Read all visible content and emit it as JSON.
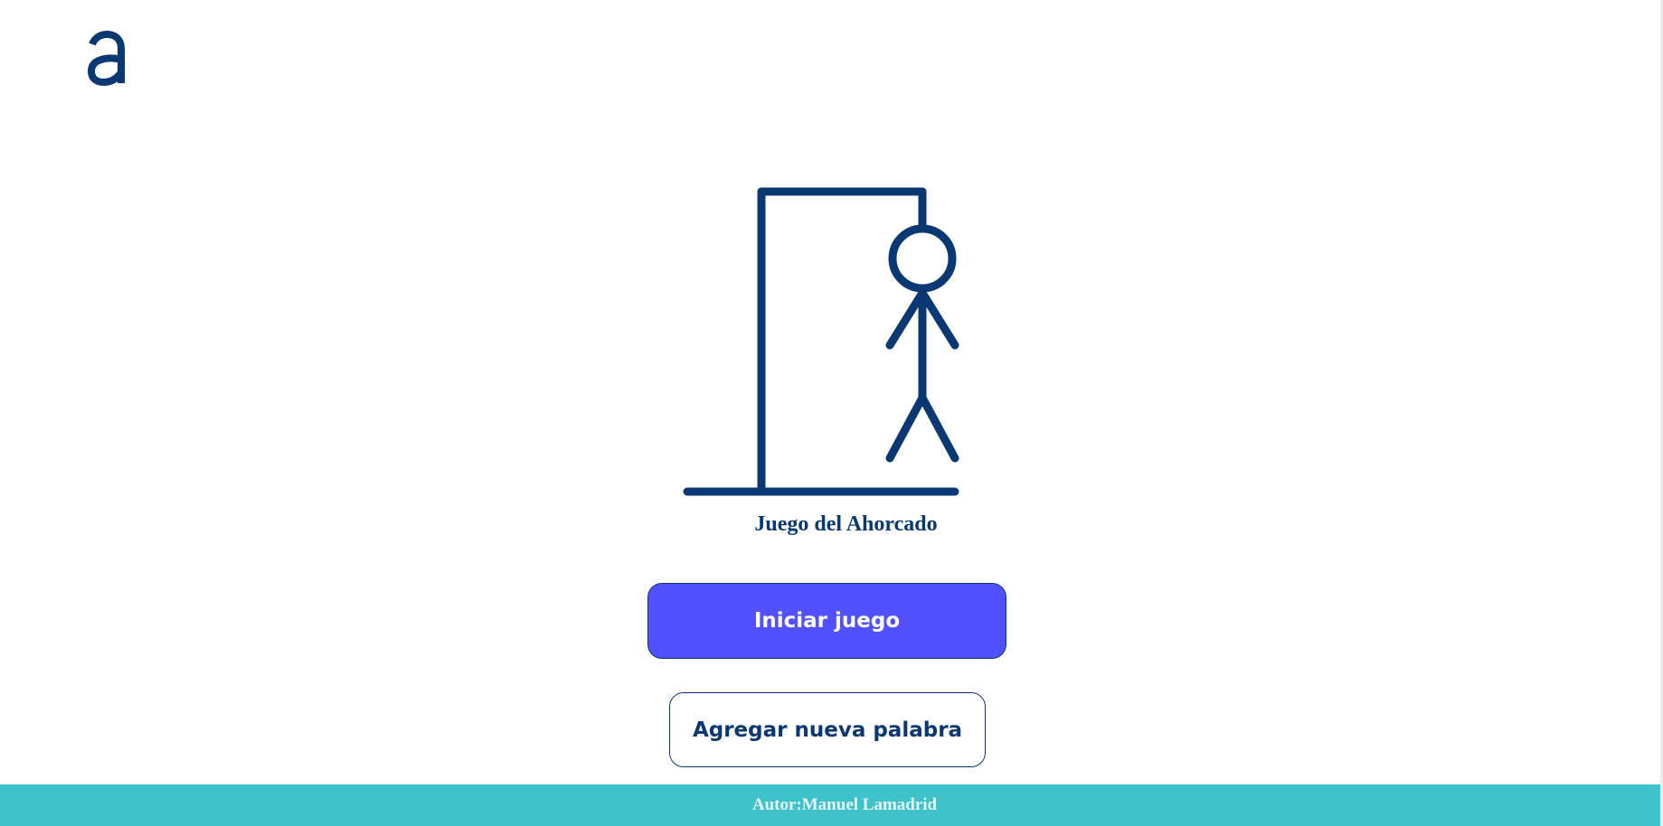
{
  "logo": {
    "icon": "letter-a-logo",
    "color": "#0a3873"
  },
  "illustration": {
    "icon": "hangman-icon",
    "color": "#0a3873"
  },
  "title": "Juego del Ahorcado",
  "buttons": {
    "start_label": "Iniciar juego",
    "add_word_label": "Agregar nueva palabra"
  },
  "footer": {
    "author_text": "Autor:Manuel Lamadrid",
    "background": "#3ec3cc"
  },
  "colors": {
    "primary": "#0a3873",
    "accent": "#5151ff"
  }
}
